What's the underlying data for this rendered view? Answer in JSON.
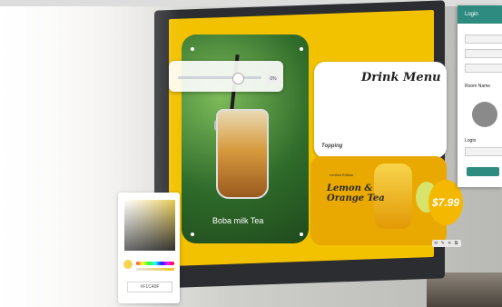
{
  "background": {
    "accent": "#f2c200",
    "panel_teal": "#2e8b80"
  },
  "slider_panel": {
    "value_label": "0%"
  },
  "photo": {
    "caption": "Boba milk Tea"
  },
  "menu": {
    "title": "Drink Menu",
    "footer_label": "Topping"
  },
  "promo": {
    "small_label": "Limited Edition",
    "line1": "Lemon &",
    "line2": "Orange Tea",
    "price": "$7.99"
  },
  "color_picker": {
    "hex_value": "#F1C40F"
  },
  "login_panel": {
    "header": "Login",
    "room_label": "Room Name",
    "login_label": "Login"
  },
  "toolbar": {
    "icons": "⟲ ✎ ✕ ⧉"
  }
}
